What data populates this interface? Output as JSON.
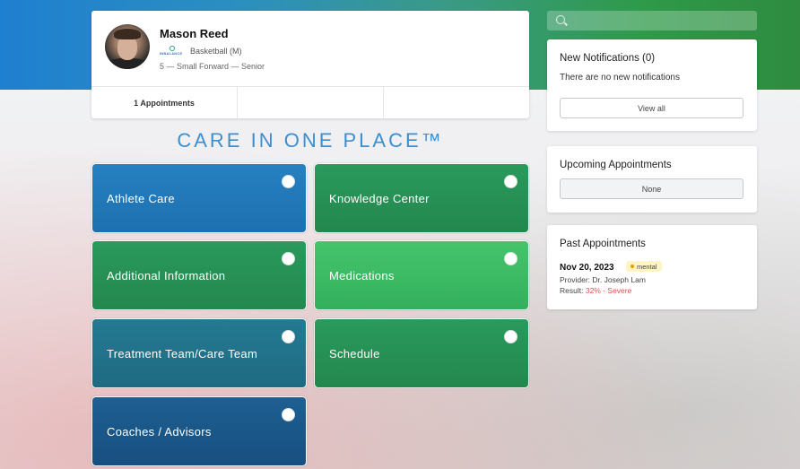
{
  "colors": {
    "header_gradient_start": "#1f7fd0",
    "header_gradient_end": "#2e8b3f",
    "care_title": "#3b8fd0",
    "severity": "#e05050"
  },
  "profile": {
    "name": "Mason Reed",
    "logo_text": "INBALANCE",
    "sport": "Basketball (M)",
    "position": "5 — Small Forward — Senior",
    "tabs": [
      "1 Appointments",
      "",
      ""
    ]
  },
  "care_title": "CARE IN ONE PLACE™",
  "tiles": [
    {
      "label": "Athlete Care",
      "color": "blue"
    },
    {
      "label": "Knowledge Center",
      "color": "green"
    },
    {
      "label": "Additional Information",
      "color": "green"
    },
    {
      "label": "Medications",
      "color": "green-bright"
    },
    {
      "label": "Treatment Team/Care Team",
      "color": "teal"
    },
    {
      "label": "Schedule",
      "color": "green"
    },
    {
      "label": "Coaches / Advisors",
      "color": "navy"
    }
  ],
  "search": {
    "placeholder": ""
  },
  "notifications": {
    "title": "New Notifications (0)",
    "empty_text": "There are no new notifications",
    "button": "View all"
  },
  "upcoming": {
    "title": "Upcoming Appointments",
    "value": "None"
  },
  "past": {
    "title": "Past Appointments",
    "date": "Nov 20, 2023",
    "badge": "mental",
    "provider": "Provider: Dr. Joseph Lam",
    "result_label": "Result:",
    "result_value": "32% - Severe"
  },
  "icons": {
    "search": "search-icon",
    "radio": "radio-circle-icon",
    "badge_dot": "dot-icon"
  }
}
